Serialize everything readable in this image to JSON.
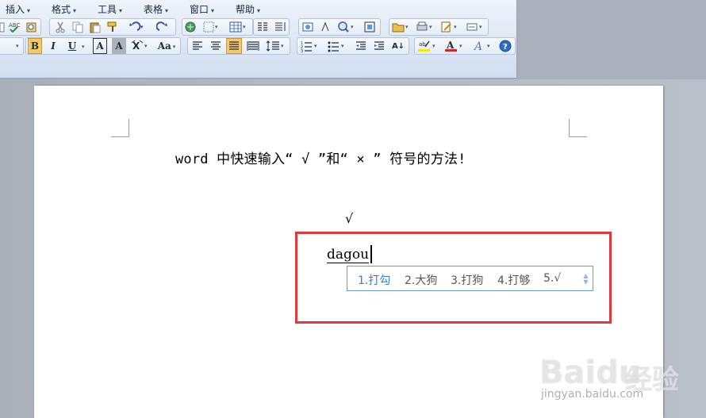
{
  "menu": [
    {
      "label": "插入"
    },
    {
      "label": "格式"
    },
    {
      "label": "工具"
    },
    {
      "label": "表格"
    },
    {
      "label": "窗口"
    },
    {
      "label": "帮助"
    }
  ],
  "toolbar": {
    "style_dropdown": "",
    "bold": "B",
    "italic": "I",
    "underline": "U",
    "char_border": "A",
    "char_shading": "A",
    "case": "Aa",
    "sort": "A↓",
    "help": "?"
  },
  "document": {
    "title": "word 中快速输入“ √ ”和“ × ”  符号的方法!",
    "check": "√",
    "typed": "dagou"
  },
  "ime": {
    "candidates": [
      {
        "label": "1.打勾"
      },
      {
        "label": "2.大狗"
      },
      {
        "label": "3.打狗"
      },
      {
        "label": "4.打够"
      },
      {
        "label": "5.√"
      }
    ]
  },
  "watermark": {
    "brand": "Baidu",
    "cn": "经验",
    "url": "jingyan.baidu.com"
  },
  "colors": {
    "highlight": "#e0383c",
    "ime_selected": "#2d7fd9",
    "toolbar_bg": "#dbe6f4"
  }
}
